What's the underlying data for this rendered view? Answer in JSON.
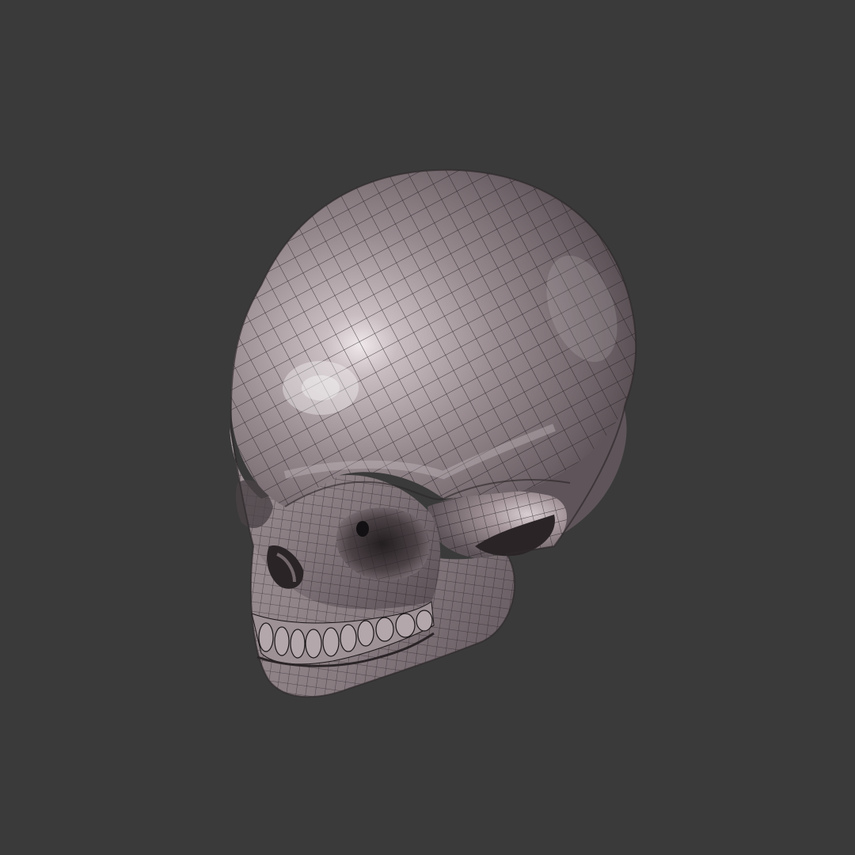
{
  "scene": {
    "subject_icon": "skull-wireframe-icon",
    "colors": {
      "background": "#3a3a3a",
      "surface_base": "#8c8085",
      "surface_light": "#d8cfd2",
      "surface_shadow": "#4a4246",
      "wireframe": "#1b1719",
      "cavity": "#121012"
    }
  }
}
